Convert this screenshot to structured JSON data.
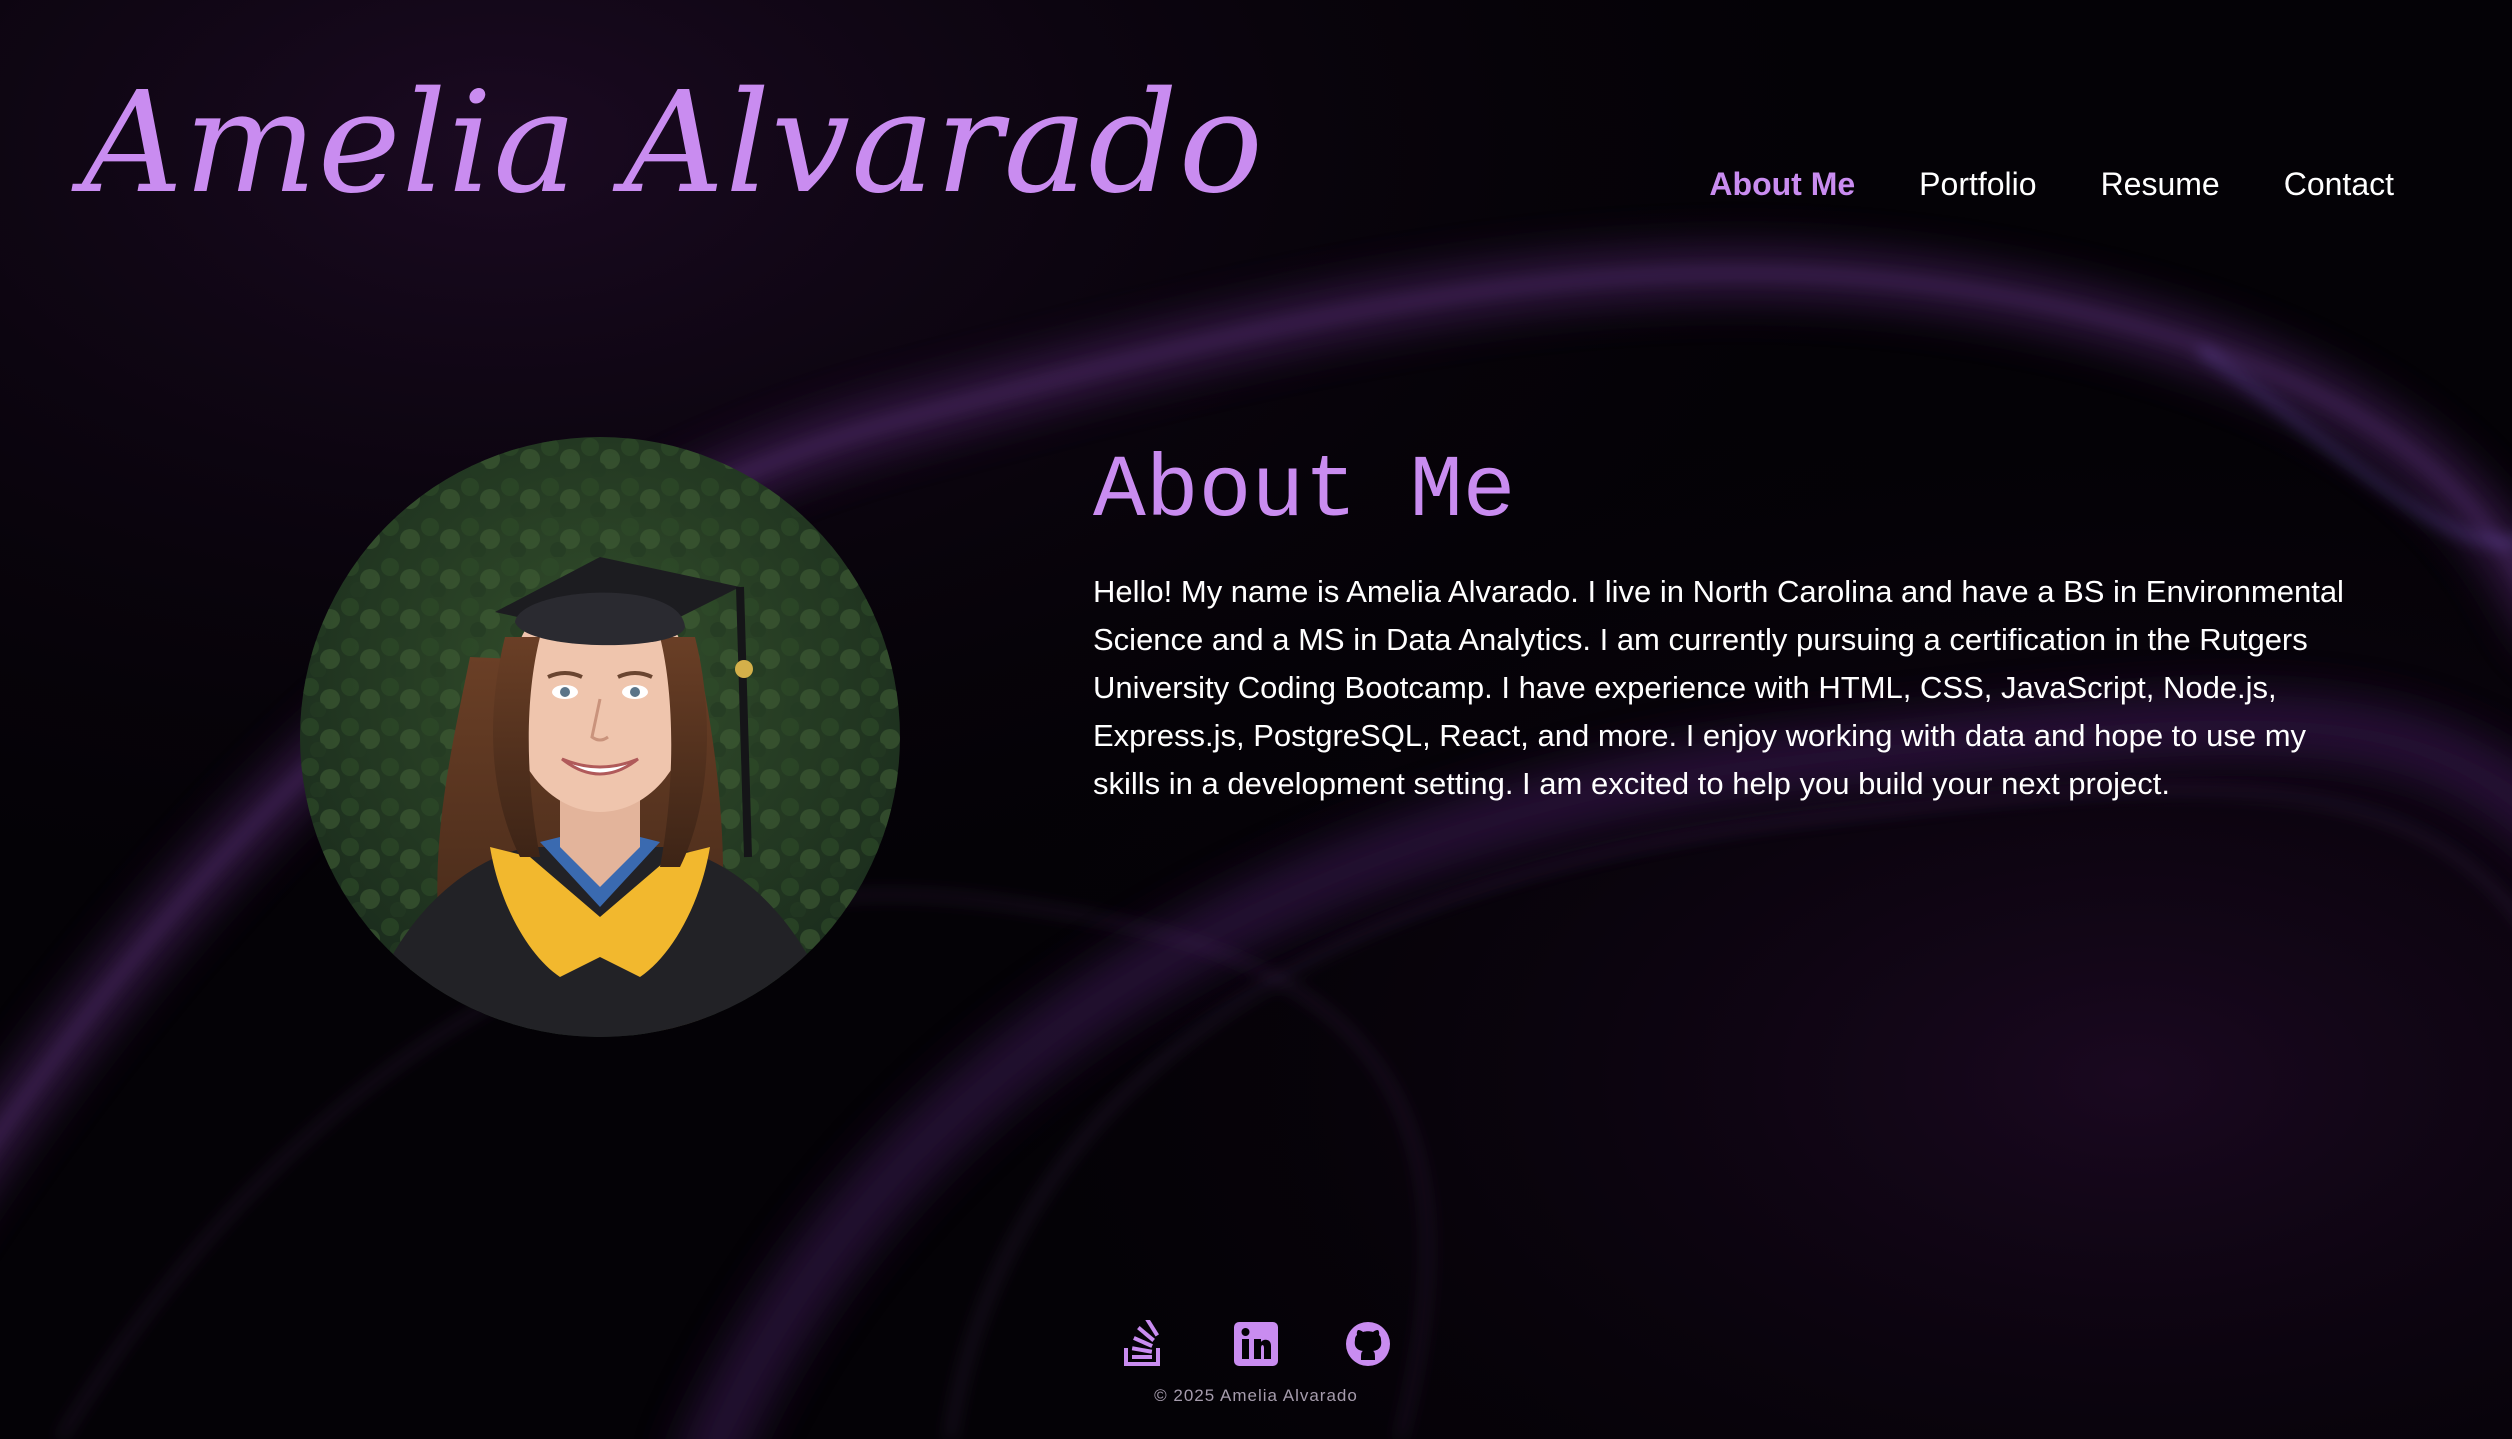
{
  "site": {
    "name": "Amelia Alvarado"
  },
  "nav": {
    "items": [
      {
        "label": "About Me",
        "active": true
      },
      {
        "label": "Portfolio",
        "active": false
      },
      {
        "label": "Resume",
        "active": false
      },
      {
        "label": "Contact",
        "active": false
      }
    ]
  },
  "about": {
    "heading": "About Me",
    "body": "Hello! My name is Amelia Alvarado. I live in North Carolina and have a BS in Environmental Science and a MS in Data Analytics. I am currently pursuing a certification in the Rutgers University Coding Bootcamp. I have experience with HTML, CSS, JavaScript, Node.js, Express.js, PostgreSQL, React, and more. I enjoy working with data and hope to use my skills in a development setting. I am excited to help you build your next project."
  },
  "footer": {
    "socials": [
      {
        "icon": "stack-overflow-icon"
      },
      {
        "icon": "linkedin-icon"
      },
      {
        "icon": "github-icon"
      }
    ],
    "copyright": "© 2025 Amelia Alvarado"
  },
  "colors": {
    "accent": "#c98cf0",
    "background": "#040206",
    "text": "#ffffff"
  }
}
